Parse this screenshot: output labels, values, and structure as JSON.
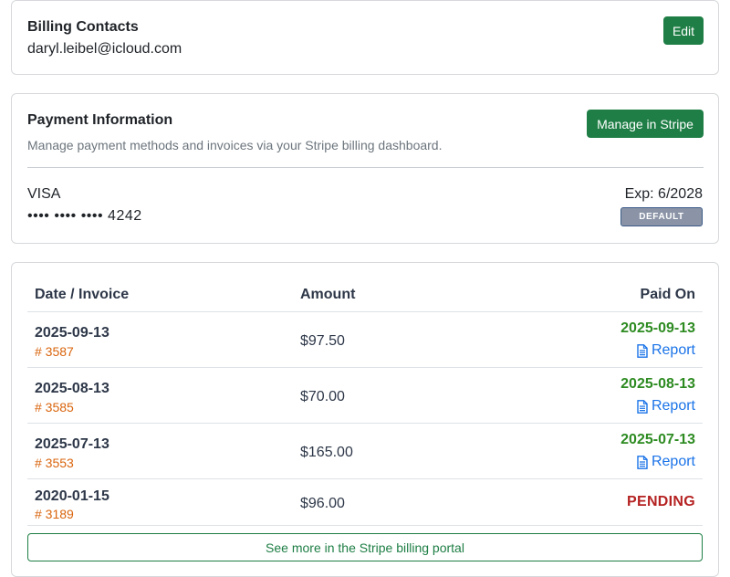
{
  "contacts": {
    "title": "Billing Contacts",
    "email": "daryl.leibel@icloud.com",
    "edit_label": "Edit"
  },
  "payment": {
    "title": "Payment Information",
    "description": "Manage payment methods and invoices via your Stripe billing dashboard.",
    "manage_label": "Manage in Stripe",
    "card_brand": "VISA",
    "card_number": "•••• •••• •••• 4242",
    "expiry": "Exp: 6/2028",
    "default_badge": "DEFAULT"
  },
  "invoices": {
    "headers": {
      "date": "Date / Invoice",
      "amount": "Amount",
      "paid": "Paid On"
    },
    "rows": [
      {
        "date": "2025-09-13",
        "invoice": "# 3587",
        "amount": "$97.50",
        "paid_on": "2025-09-13",
        "report": "Report"
      },
      {
        "date": "2025-08-13",
        "invoice": "# 3585",
        "amount": "$70.00",
        "paid_on": "2025-08-13",
        "report": "Report"
      },
      {
        "date": "2025-07-13",
        "invoice": "# 3553",
        "amount": "$165.00",
        "paid_on": "2025-07-13",
        "report": "Report"
      },
      {
        "date": "2020-01-15",
        "invoice": "# 3189",
        "amount": "$96.00",
        "status": "PENDING"
      }
    ],
    "see_more_label": "See more in the Stripe billing portal"
  },
  "colors": {
    "button_green": "#1e7e45",
    "paid_green": "#2e8b22",
    "pending_red": "#b52222",
    "invoice_orange": "#d9640c",
    "link_blue": "#1a73e8"
  }
}
